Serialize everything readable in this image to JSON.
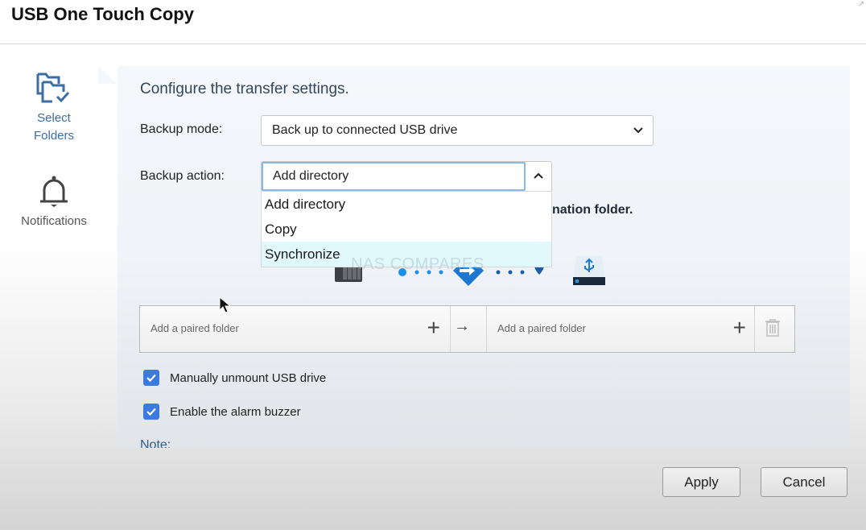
{
  "window": {
    "title": "USB One Touch Copy"
  },
  "sidebar": {
    "items": [
      {
        "label_line1": "Select",
        "label_line2": "Folders",
        "icon": "folders-check-icon",
        "active": true
      },
      {
        "label": "Notifications",
        "icon": "bell-icon",
        "active": false
      }
    ]
  },
  "main": {
    "heading": "Configure the transfer settings.",
    "backup_mode": {
      "label": "Backup mode:",
      "value": "Back up to connected USB drive"
    },
    "backup_action": {
      "label": "Backup action:",
      "value": "Add directory",
      "expanded": true,
      "options": [
        "Add directory",
        "Copy",
        "Synchronize"
      ],
      "highlighted": "Synchronize"
    },
    "partially_hidden_text": "nation folder.",
    "watermark": "NAS COMPARES",
    "paired_folders": {
      "source_placeholder": "Add a paired folder",
      "destination_placeholder": "Add a paired folder"
    },
    "options": [
      {
        "label": "Manually unmount USB drive",
        "checked": true
      },
      {
        "label": "Enable the alarm buzzer",
        "checked": true
      }
    ],
    "note_label": "Note:"
  },
  "footer": {
    "apply_label": "Apply",
    "cancel_label": "Cancel"
  },
  "colors": {
    "accent": "#3d7ae0",
    "sidebar_active": "#3a6ea5",
    "dropdown_highlight": "#e1f9fd",
    "focus_border": "#8ab6ea"
  }
}
